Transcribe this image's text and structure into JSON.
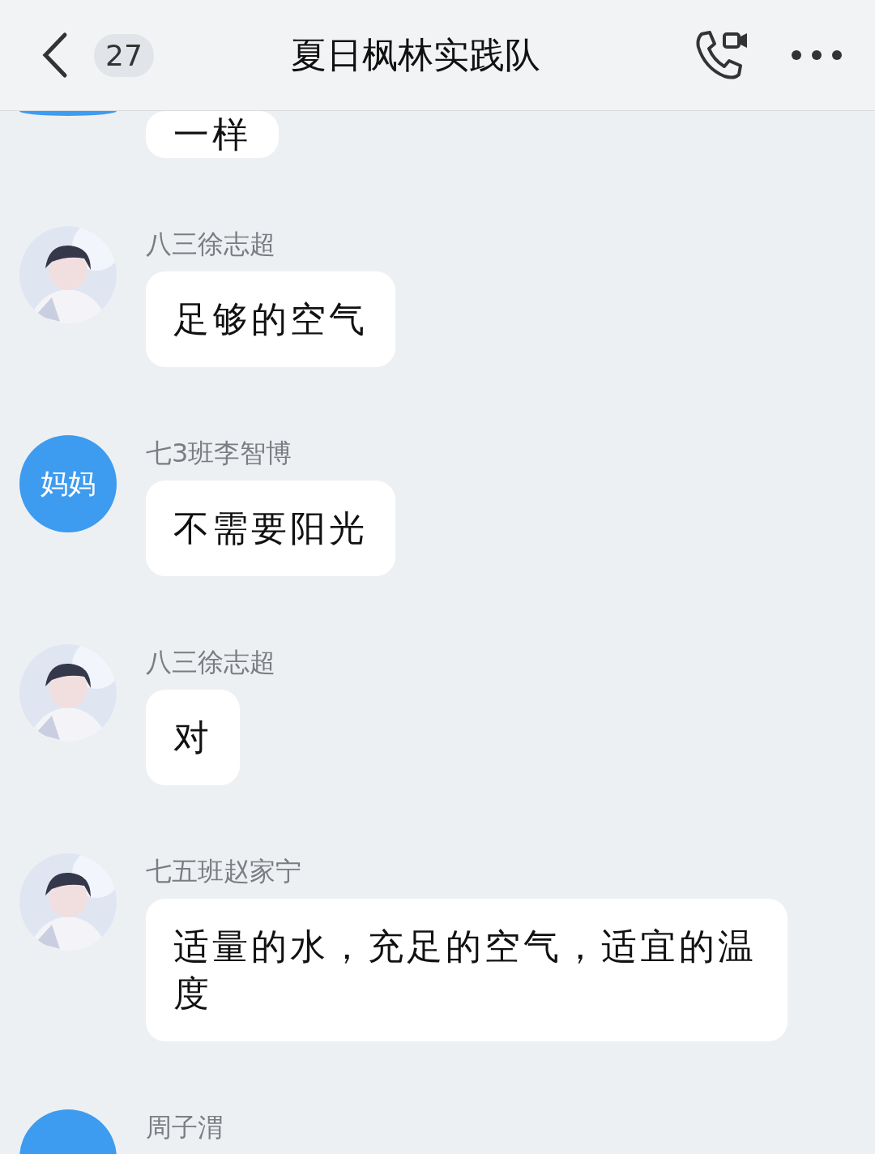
{
  "header": {
    "unread_count": "27",
    "title": "夏日枫林实践队"
  },
  "messages": [
    {
      "avatar": {
        "kind": "text",
        "color": "#3d9bf0"
      },
      "text": "一样"
    },
    {
      "sender": "八三徐志超",
      "text": "足够的空气"
    },
    {
      "sender": "七3班李智博",
      "avatar": {
        "kind": "text",
        "text": "妈妈",
        "color": "#3d9bf0"
      },
      "text": "不需要阳光"
    },
    {
      "sender": "八三徐志超",
      "text": "对"
    },
    {
      "sender": "七五班赵家宁",
      "text": "适量的水，充足的空气，适宜的温度"
    },
    {
      "sender": "周子渭",
      "avatar": {
        "kind": "text",
        "color": "#3d9bf0"
      }
    }
  ]
}
